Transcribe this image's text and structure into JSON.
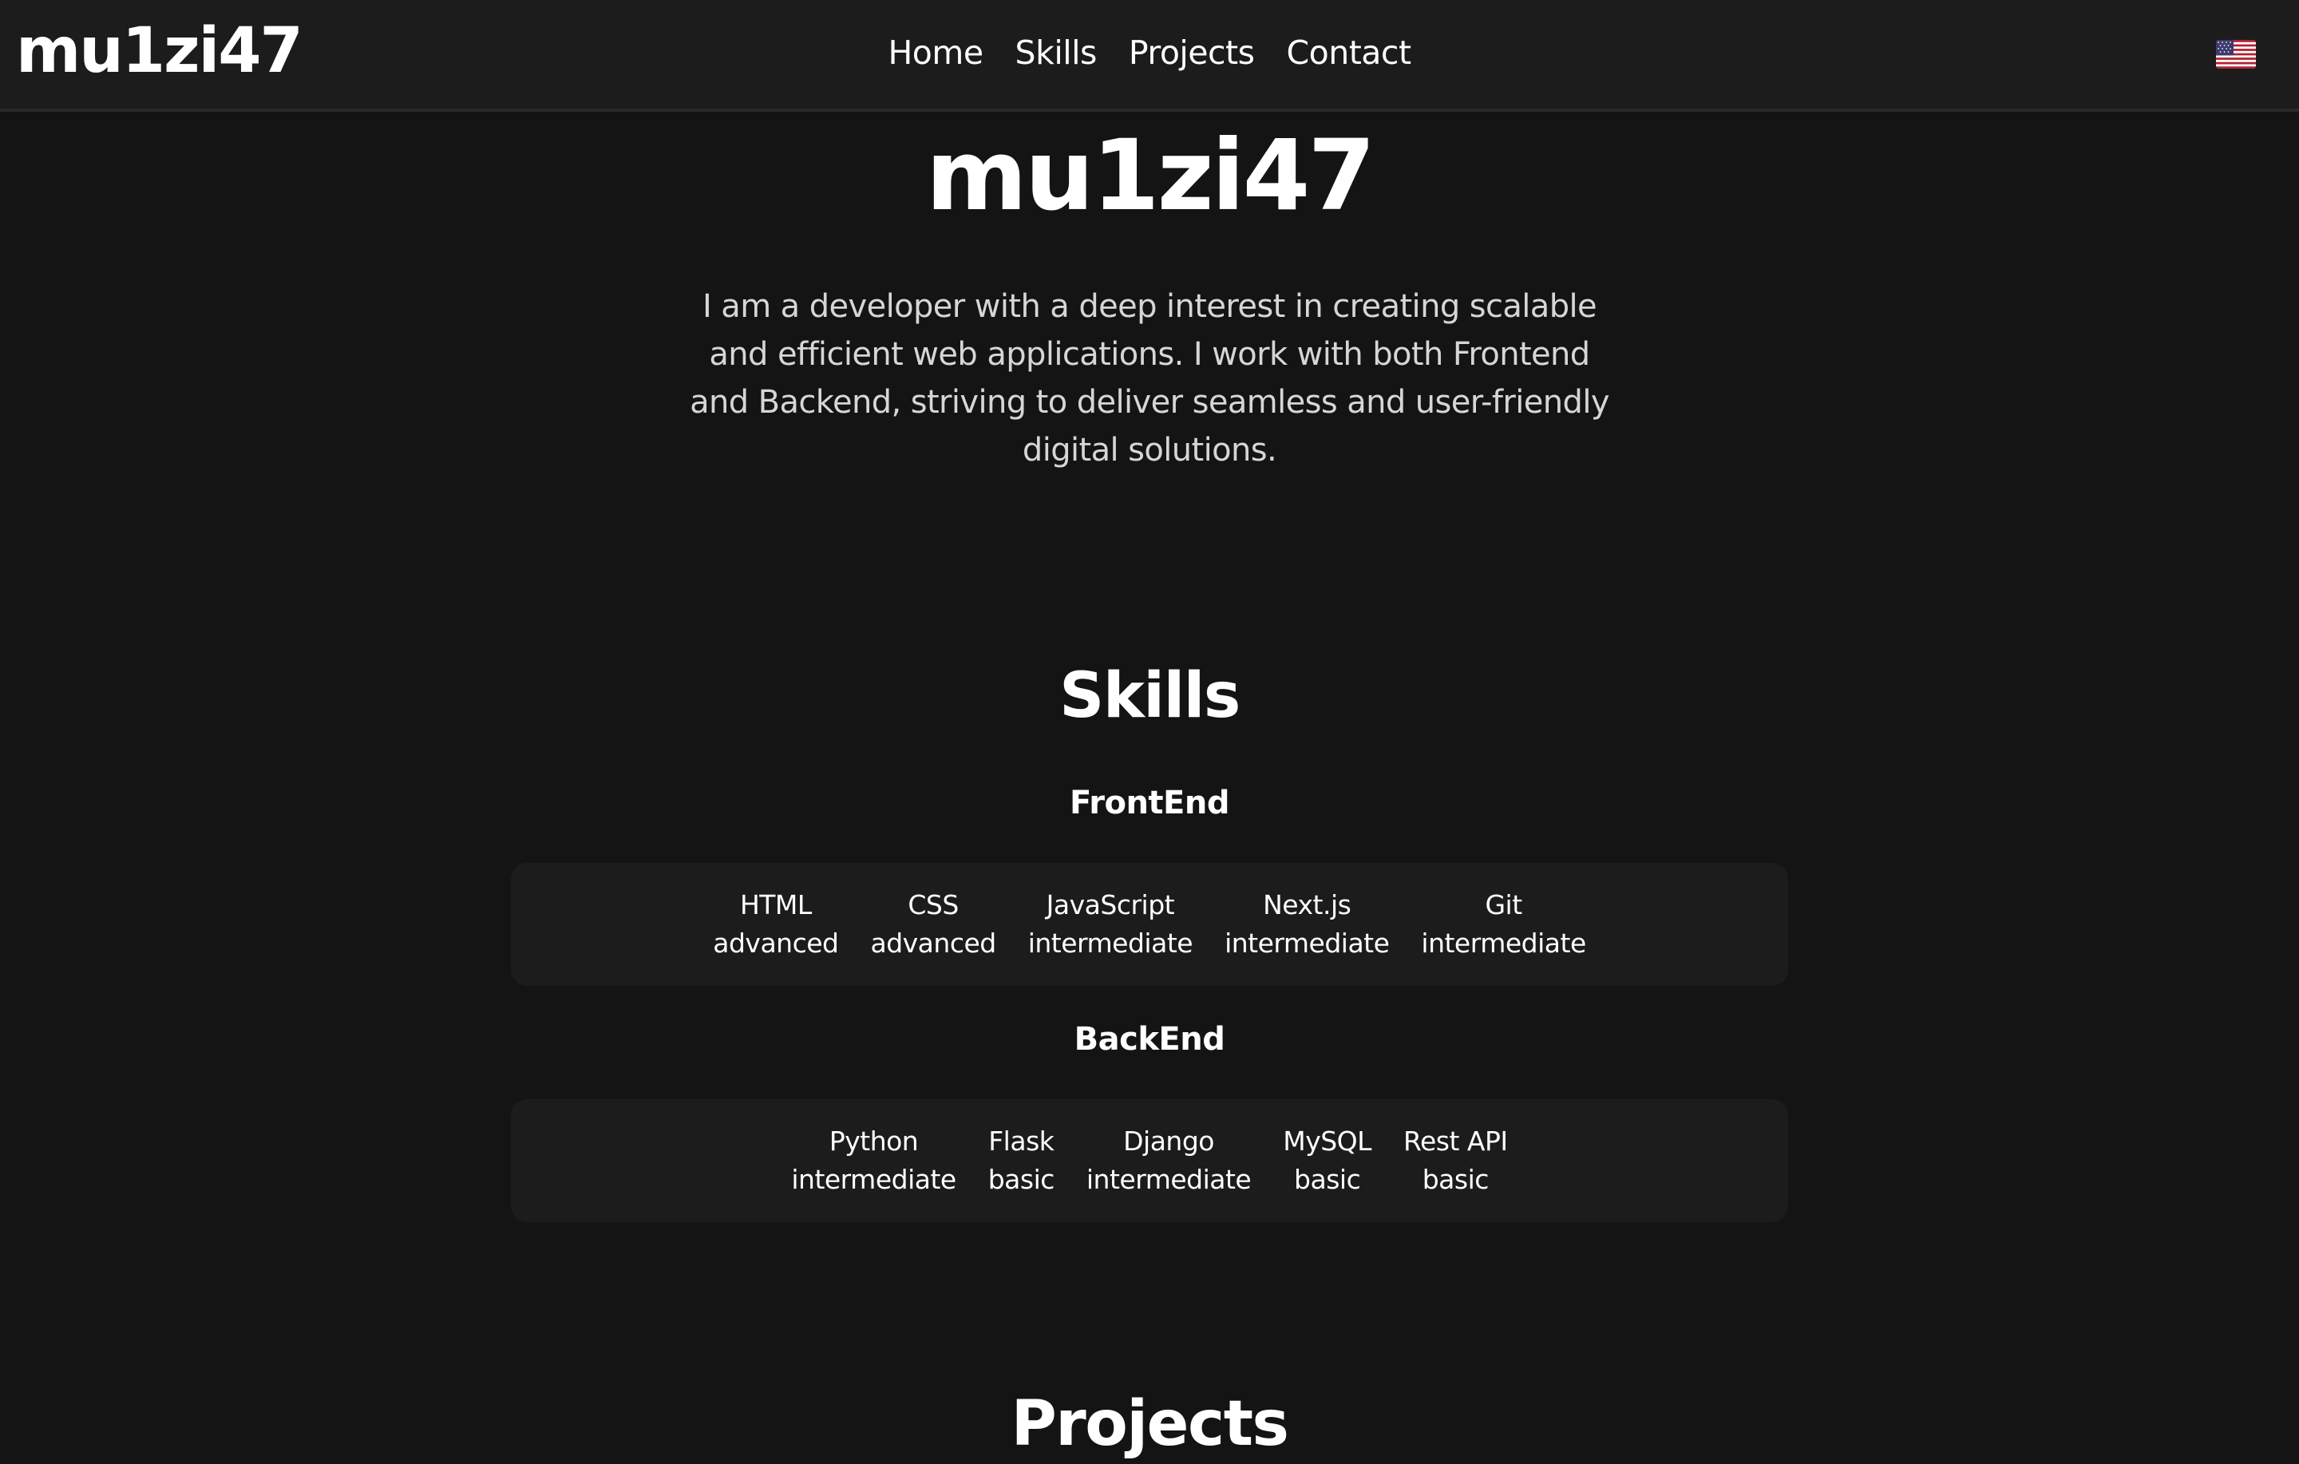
{
  "nav": {
    "logo": "mu1zi47",
    "links": [
      "Home",
      "Skills",
      "Projects",
      "Contact"
    ],
    "language_flag": "us-flag-icon"
  },
  "hero": {
    "title": "mu1zi47",
    "description": "I am a developer with a deep interest in creating scalable and efficient web applications. I work with both Frontend and Backend, striving to deliver seamless and user-friendly digital solutions."
  },
  "skills": {
    "title": "Skills",
    "frontend": {
      "title": "FrontEnd",
      "items": [
        {
          "name": "HTML",
          "level": "advanced"
        },
        {
          "name": "CSS",
          "level": "advanced"
        },
        {
          "name": "JavaScript",
          "level": "intermediate"
        },
        {
          "name": "Next.js",
          "level": "intermediate"
        },
        {
          "name": "Git",
          "level": "intermediate"
        }
      ]
    },
    "backend": {
      "title": "BackEnd",
      "items": [
        {
          "name": "Python",
          "level": "intermediate"
        },
        {
          "name": "Flask",
          "level": "basic"
        },
        {
          "name": "Django",
          "level": "intermediate"
        },
        {
          "name": "MySQL",
          "level": "basic"
        },
        {
          "name": "Rest API",
          "level": "basic"
        }
      ]
    }
  },
  "projects": {
    "title": "Projects"
  }
}
